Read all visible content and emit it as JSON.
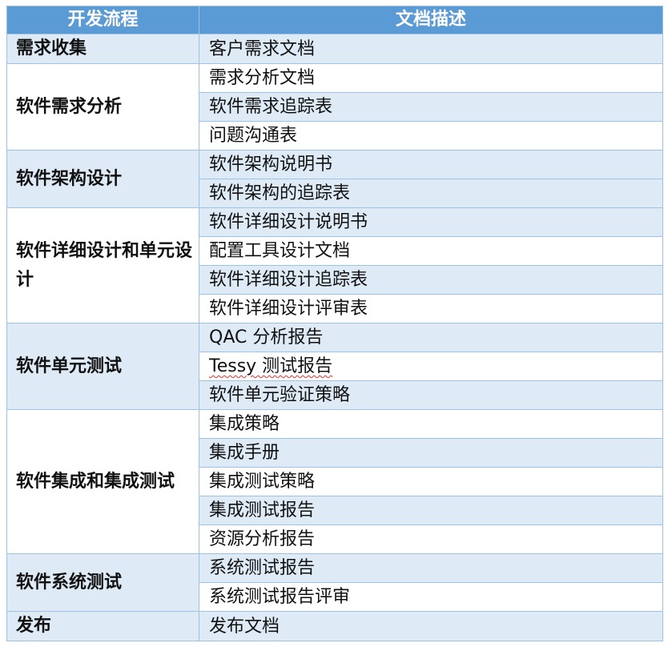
{
  "table": {
    "headers": [
      "开发流程",
      "文档描述"
    ],
    "groups": [
      {
        "phase": "需求收集",
        "docs": [
          "客户需求文档"
        ]
      },
      {
        "phase": "软件需求分析",
        "docs": [
          "需求分析文档",
          "软件需求追踪表",
          "问题沟通表"
        ]
      },
      {
        "phase": "软件架构设计",
        "docs": [
          "软件架构说明书",
          "软件架构的追踪表"
        ]
      },
      {
        "phase": "软件详细设计和单元设计",
        "docs": [
          "软件详细设计说明书",
          "配置工具设计文档",
          "软件详细设计追踪表",
          "软件详细设计评审表"
        ]
      },
      {
        "phase": "软件单元测试",
        "docs": [
          "QAC 分析报告",
          "Tessy 测试报告",
          "软件单元验证策略"
        ]
      },
      {
        "phase": "软件集成和集成测试",
        "docs": [
          "集成策略",
          "集成手册",
          "集成测试策略",
          "集成测试报告",
          "资源分析报告"
        ]
      },
      {
        "phase": "软件系统测试",
        "docs": [
          "系统测试报告",
          "系统测试报告评审"
        ]
      },
      {
        "phase": "发布",
        "docs": [
          "发布文档"
        ]
      }
    ]
  },
  "colors": {
    "header_bg": "#5b9bd5",
    "band_bg": "#deeaf6",
    "border": "#9cc2e5",
    "text": "#111111"
  }
}
